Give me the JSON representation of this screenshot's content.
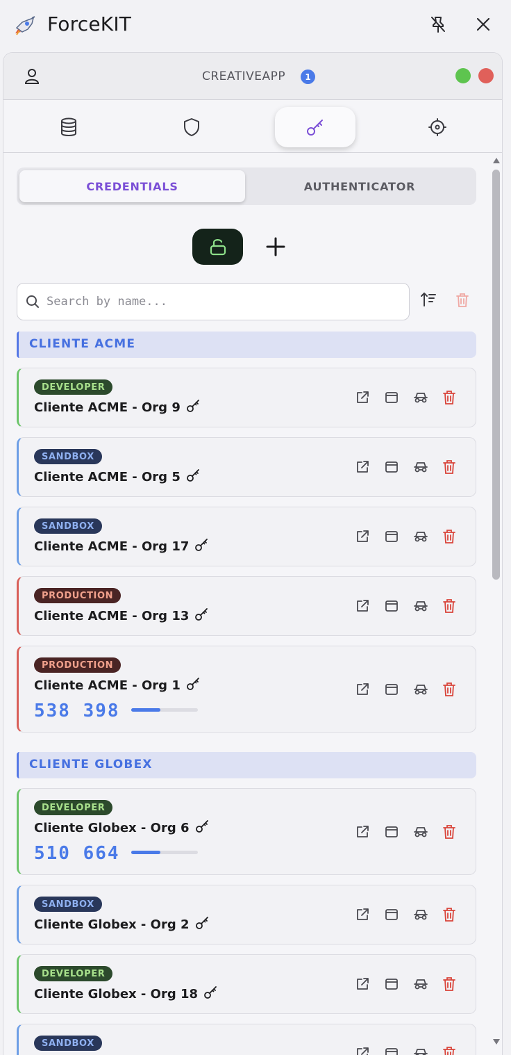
{
  "app": {
    "title": "ForceKIT"
  },
  "org_header": {
    "name": "CREATIVEAPP",
    "badge_count": "1"
  },
  "tabs": [
    {
      "name": "database-icon",
      "active": false
    },
    {
      "name": "shield-icon",
      "active": false
    },
    {
      "name": "key-icon",
      "active": true
    },
    {
      "name": "settings-icon",
      "active": false
    }
  ],
  "segment": {
    "credentials": "CREDENTIALS",
    "authenticator": "AUTHENTICATOR",
    "active": "credentials"
  },
  "search": {
    "placeholder": "Search by name..."
  },
  "colors": {
    "accent": "#7b4fd6",
    "blue": "#4a7ae8",
    "developer": "#6cc56a",
    "sandbox": "#6e9fe6",
    "production": "#d9605a",
    "danger": "#d9443a",
    "green_dot": "#5ec44f",
    "red_dot": "#e0605a"
  },
  "groups": [
    {
      "name": "CLIENTE ACME",
      "orgs": [
        {
          "type": "DEVELOPER",
          "name": "Cliente ACME - Org 9"
        },
        {
          "type": "SANDBOX",
          "name": "Cliente ACME - Org 5"
        },
        {
          "type": "SANDBOX",
          "name": "Cliente ACME - Org 17"
        },
        {
          "type": "PRODUCTION",
          "name": "Cliente ACME - Org 13"
        },
        {
          "type": "PRODUCTION",
          "name": "Cliente ACME - Org 1",
          "otp": "538 398",
          "otp_progress": 0.44
        }
      ]
    },
    {
      "name": "CLIENTE GLOBEX",
      "orgs": [
        {
          "type": "DEVELOPER",
          "name": "Cliente Globex - Org 6",
          "otp": "510 664",
          "otp_progress": 0.44
        },
        {
          "type": "SANDBOX",
          "name": "Cliente Globex - Org 2"
        },
        {
          "type": "DEVELOPER",
          "name": "Cliente Globex - Org 18"
        },
        {
          "type": "SANDBOX",
          "name": ""
        }
      ]
    }
  ]
}
